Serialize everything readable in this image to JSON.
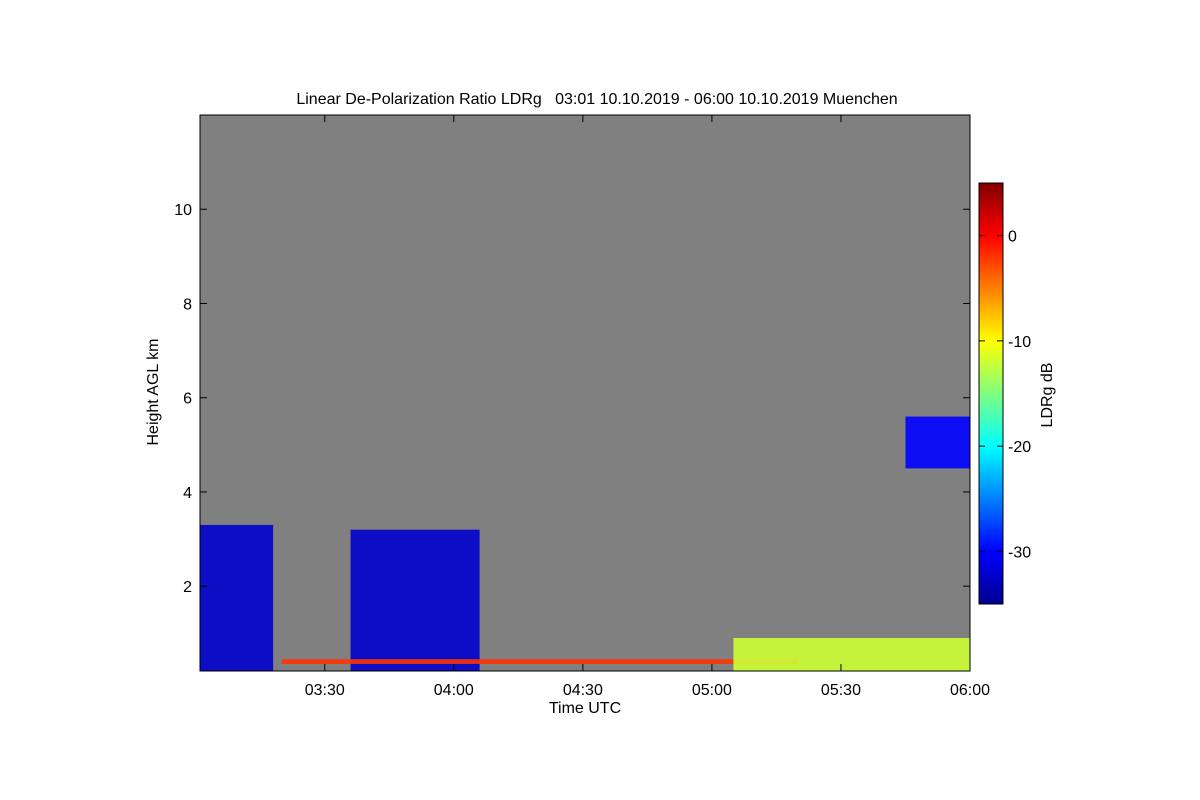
{
  "chart_data": {
    "type": "heatmap",
    "title": "Linear De-Polarization Ratio LDRg   03:01 10.10.2019 - 06:00 10.10.2019 Muenchen",
    "xlabel": "Time UTC",
    "ylabel": "Height AGL km",
    "xlim": [
      "03:01",
      "06:00"
    ],
    "ylim": [
      0.2,
      12.0
    ],
    "x_ticks": [
      "03:30",
      "04:00",
      "04:30",
      "05:00",
      "05:30",
      "06:00"
    ],
    "y_ticks": [
      "2",
      "4",
      "6",
      "8",
      "10"
    ],
    "background": "#808080",
    "colorbar": {
      "label": "LDRg dB",
      "range": [
        -35,
        5
      ],
      "ticks": [
        "0",
        "-10",
        "-20",
        "-30"
      ],
      "colormap": "jet"
    },
    "features": [
      {
        "time_start": "03:01",
        "time_end": "03:18",
        "height_base_km": 0.2,
        "height_top_km": 3.3,
        "ldr_db": -32
      },
      {
        "time_start": "03:36",
        "time_end": "04:06",
        "height_base_km": 0.2,
        "height_top_km": 3.2,
        "ldr_db": -32
      },
      {
        "time_start": "05:45",
        "time_end": "06:00",
        "height_base_km": 4.5,
        "height_top_km": 5.6,
        "ldr_db": -30
      },
      {
        "time_start": "03:20",
        "time_end": "05:20",
        "height_base_km": 0.35,
        "height_top_km": 0.45,
        "ldr_db": -2
      },
      {
        "time_start": "05:05",
        "time_end": "06:00",
        "height_base_km": 0.2,
        "height_top_km": 0.9,
        "ldr_db": -12
      }
    ]
  }
}
